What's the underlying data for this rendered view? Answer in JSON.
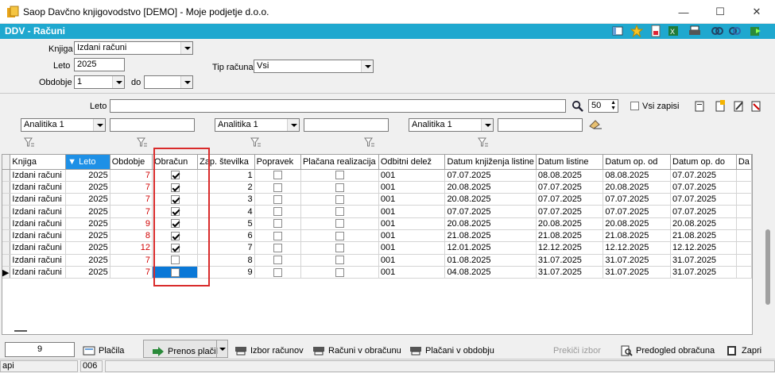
{
  "window": {
    "title": "Saop Davčno knjigovodstvo [DEMO] - Moje podjetje d.o.o."
  },
  "module": {
    "title": "DDV - Računi"
  },
  "colors": {
    "accent": "#1fa8cf",
    "selection": "#0a78d7",
    "sorted_header": "#1e90e6",
    "highlight_box": "#d92b2b"
  },
  "form": {
    "knjiga_label": "Knjiga",
    "knjiga_value": "Izdani računi",
    "leto_label": "Leto",
    "leto_value": "2025",
    "tip_label": "Tip računa",
    "tip_value": "Vsi",
    "obdobje_label": "Obdobje",
    "obdobje_value": "1",
    "do_label": "do",
    "do_value": ""
  },
  "search": {
    "leto_label": "Leto",
    "leto_value": "",
    "count": "50",
    "vsi_zapisi_label": "Vsi zapisi",
    "analitika_1": "Analitika 1",
    "analitika_2": "Analitika 1",
    "analitika_3": "Analitika 1"
  },
  "table": {
    "headers": [
      "Knjiga",
      "Leto",
      "Obdobje",
      "Obračun",
      "Zap. številka",
      "Popravek",
      "Plačana realizacija",
      "Odbitni delež",
      "Datum knjiženja listine",
      "Datum listine",
      "Datum op. od",
      "Datum op. do",
      "Da"
    ],
    "rows": [
      {
        "knjiga": "Izdani računi",
        "leto": "2025",
        "obdobje": "7",
        "obracun": true,
        "zap": "1",
        "datum_knjizenja": "07.07.2025",
        "datum_listine": "08.08.2025",
        "op_od": "08.08.2025",
        "op_do": "07.07.2025",
        "odbitni": "001"
      },
      {
        "knjiga": "Izdani računi",
        "leto": "2025",
        "obdobje": "7",
        "obracun": true,
        "zap": "2",
        "datum_knjizenja": "20.08.2025",
        "datum_listine": "07.07.2025",
        "op_od": "20.08.2025",
        "op_do": "07.07.2025",
        "odbitni": "001"
      },
      {
        "knjiga": "Izdani računi",
        "leto": "2025",
        "obdobje": "7",
        "obracun": true,
        "zap": "3",
        "datum_knjizenja": "20.08.2025",
        "datum_listine": "07.07.2025",
        "op_od": "07.07.2025",
        "op_do": "07.07.2025",
        "odbitni": "001"
      },
      {
        "knjiga": "Izdani računi",
        "leto": "2025",
        "obdobje": "7",
        "obracun": true,
        "zap": "4",
        "datum_knjizenja": "07.07.2025",
        "datum_listine": "07.07.2025",
        "op_od": "07.07.2025",
        "op_do": "07.07.2025",
        "odbitni": "001"
      },
      {
        "knjiga": "Izdani računi",
        "leto": "2025",
        "obdobje": "9",
        "obracun": true,
        "zap": "5",
        "datum_knjizenja": "20.08.2025",
        "datum_listine": "20.08.2025",
        "op_od": "20.08.2025",
        "op_do": "20.08.2025",
        "odbitni": "001"
      },
      {
        "knjiga": "Izdani računi",
        "leto": "2025",
        "obdobje": "8",
        "obracun": true,
        "zap": "6",
        "datum_knjizenja": "21.08.2025",
        "datum_listine": "21.08.2025",
        "op_od": "21.08.2025",
        "op_do": "21.08.2025",
        "odbitni": "001"
      },
      {
        "knjiga": "Izdani računi",
        "leto": "2025",
        "obdobje": "12",
        "obracun": true,
        "zap": "7",
        "datum_knjizenja": "12.01.2025",
        "datum_listine": "12.12.2025",
        "op_od": "12.12.2025",
        "op_do": "12.12.2025",
        "odbitni": "001"
      },
      {
        "knjiga": "Izdani računi",
        "leto": "2025",
        "obdobje": "7",
        "obracun": false,
        "zap": "8",
        "datum_knjizenja": "01.08.2025",
        "datum_listine": "31.07.2025",
        "op_od": "31.07.2025",
        "op_do": "31.07.2025",
        "odbitni": "001"
      },
      {
        "knjiga": "Izdani računi",
        "leto": "2025",
        "obdobje": "7",
        "obracun": false,
        "zap": "9",
        "datum_knjizenja": "04.08.2025",
        "datum_listine": "31.07.2025",
        "op_od": "31.07.2025",
        "op_do": "31.07.2025",
        "odbitni": "001"
      }
    ]
  },
  "bottom": {
    "count": "9",
    "placila": "Plačila",
    "prenos_placil": "Prenos plačil",
    "izbor_racunov": "Izbor računov",
    "racuni_v_obracunu": "Računi v obračunu",
    "placani_v_obdobju": "Plačani v obdobju",
    "prekini_izbor": "Prekiči izbor",
    "predogled_obracuna": "Predogled obračuna",
    "zapri": "Zapri"
  },
  "status": {
    "c1": "api",
    "c2": "006",
    "c3": ""
  }
}
